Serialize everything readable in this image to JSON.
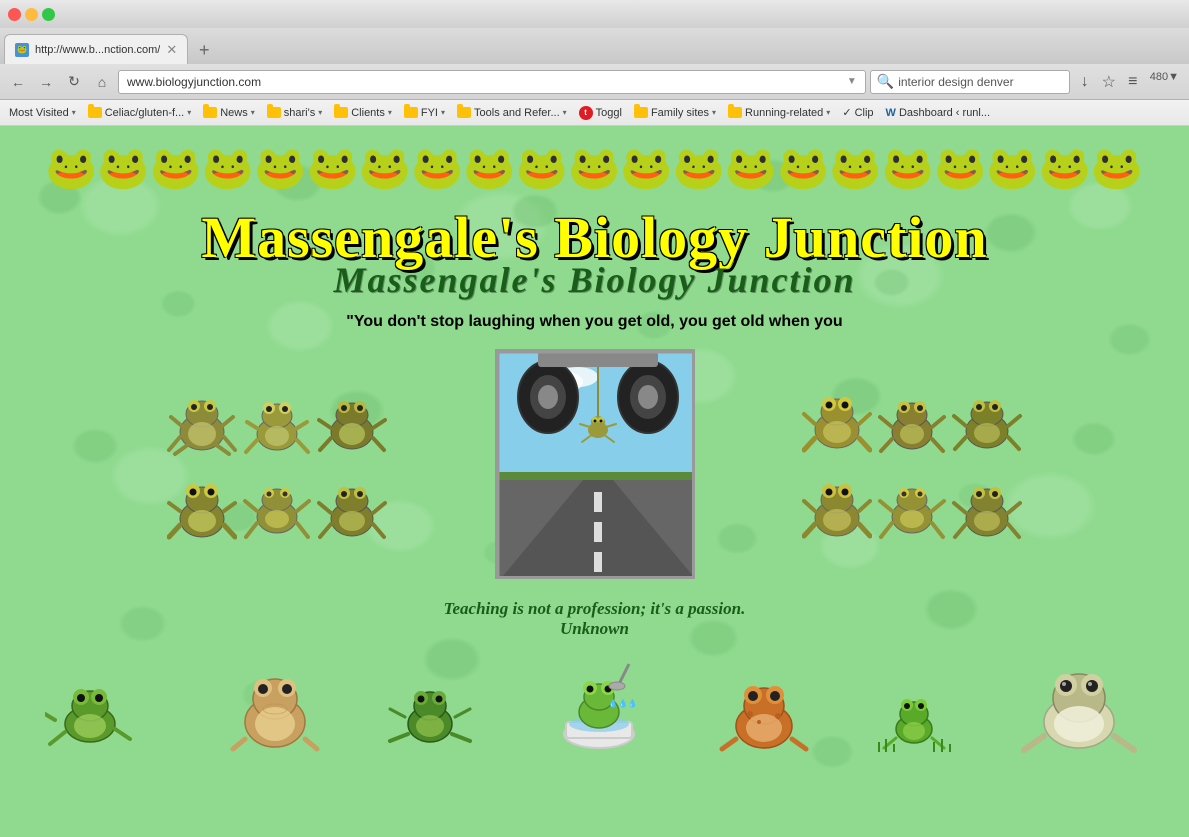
{
  "browser": {
    "title": "http://www.b...nction.com/",
    "tab_label": "http://www.b...nction.com/",
    "tab_favicon": "🐸",
    "url": "www.biologyjunction.com",
    "url_dropdown": "▼",
    "search_placeholder": "interior design denver",
    "search_icon": "🔍",
    "refresh_icon": "↻",
    "back_icon": "←",
    "forward_icon": "→",
    "home_icon": "⌂",
    "star_icon": "☆",
    "menu_icon": "≡",
    "download_icon": "↓",
    "settings_icon": "⚙"
  },
  "bookmarks": [
    {
      "label": "Most Visited",
      "type": "folder",
      "has_arrow": true
    },
    {
      "label": "Celiac/gluten-f...",
      "type": "folder",
      "has_arrow": true
    },
    {
      "label": "News",
      "type": "folder",
      "has_arrow": true
    },
    {
      "label": "shari's",
      "type": "folder",
      "has_arrow": true
    },
    {
      "label": "Clients",
      "type": "folder",
      "has_arrow": true
    },
    {
      "label": "FYI",
      "type": "folder",
      "has_arrow": true
    },
    {
      "label": "Tools and Refer...",
      "type": "folder",
      "has_arrow": true
    },
    {
      "label": "Toggl",
      "type": "toggl",
      "has_arrow": false
    },
    {
      "label": "Family sites",
      "type": "folder",
      "has_arrow": true
    },
    {
      "label": "Running-related",
      "type": "folder",
      "has_arrow": true
    },
    {
      "label": "✓ Clip",
      "type": "text",
      "has_arrow": false
    },
    {
      "label": "Dashboard ‹ runl...",
      "type": "wp",
      "has_arrow": false
    }
  ],
  "website": {
    "main_title": "Massengale's Biology Junction",
    "sub_title": "Massengale's Biology Junction",
    "quote": "\"You don't stop laughing when you get old, you get old when you",
    "passion_line1": "Teaching is not a profession; it's a passion.",
    "passion_line2": "Unknown",
    "bg_color": "#8fda8f"
  },
  "dancing_frogs": "🐸🐸🐸🐸🐸🐸🐸🐸🐸🐸🐸🐸🐸🐸🐸🐸🐸🐸🐸🐸🐸🐸🐸🐸",
  "side_frogs_left": [
    "🐸",
    "🐸",
    "🐸",
    "🐸",
    "🐸",
    "🐸"
  ],
  "side_frogs_right": [
    "🐸",
    "🐸",
    "🐸",
    "🐸",
    "🐸",
    "🐸"
  ],
  "bottom_frogs": [
    "🐸",
    "🐸",
    "🐸",
    "🐸",
    "🐸",
    "🐸"
  ]
}
